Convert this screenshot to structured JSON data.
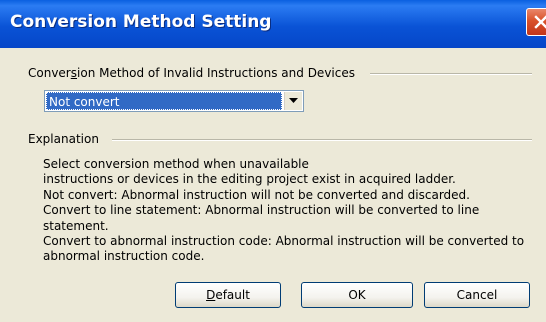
{
  "window": {
    "title": "Conversion Method Setting"
  },
  "icons": {
    "close": "close-icon",
    "dropdown": "chevron-down-icon"
  },
  "colors": {
    "titlebar": "#0a53d6",
    "close_button": "#d9522a",
    "selection": "#316ac5",
    "dialog_background": "#ece9d8"
  },
  "conversion_group": {
    "label_pre": "Conver",
    "label_accel": "s",
    "label_post": "ion Method of Invalid Instructions and Devices",
    "selected_value": "Not convert"
  },
  "explanation": {
    "label": "Explanation",
    "lines": [
      "Select conversion method when unavailable",
      "instructions or devices in the editing project exist in acquired ladder.",
      "Not convert: Abnormal instruction will not be converted and discarded.",
      "Convert to line statement: Abnormal instruction will be converted to line",
      "statement.",
      "Convert to abnormal instruction code: Abnormal instruction will be converted to",
      "abnormal instruction code."
    ]
  },
  "buttons": {
    "default_accel": "D",
    "default_rest": "efault",
    "ok": "OK",
    "cancel": "Cancel"
  }
}
